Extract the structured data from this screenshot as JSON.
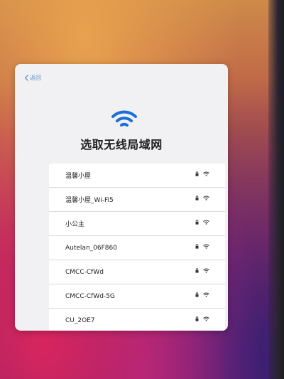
{
  "header": {
    "back_label": "返回"
  },
  "page": {
    "title": "选取无线局域网"
  },
  "networks": [
    {
      "name": "温馨小屋"
    },
    {
      "name": "温馨小屋_Wi-Fi5"
    },
    {
      "name": "小公主"
    },
    {
      "name": "Autelan_06F860"
    },
    {
      "name": "CMCC-CfWd"
    },
    {
      "name": "CMCC-CfWd-5G"
    },
    {
      "name": "CU_2OE7"
    }
  ],
  "icons": {
    "back": "chevron-left-icon",
    "hero": "wifi-icon",
    "lock": "lock-icon",
    "signal": "wifi-icon"
  },
  "colors": {
    "accent": "#1a6fd6",
    "back_link": "#6a96cf"
  }
}
